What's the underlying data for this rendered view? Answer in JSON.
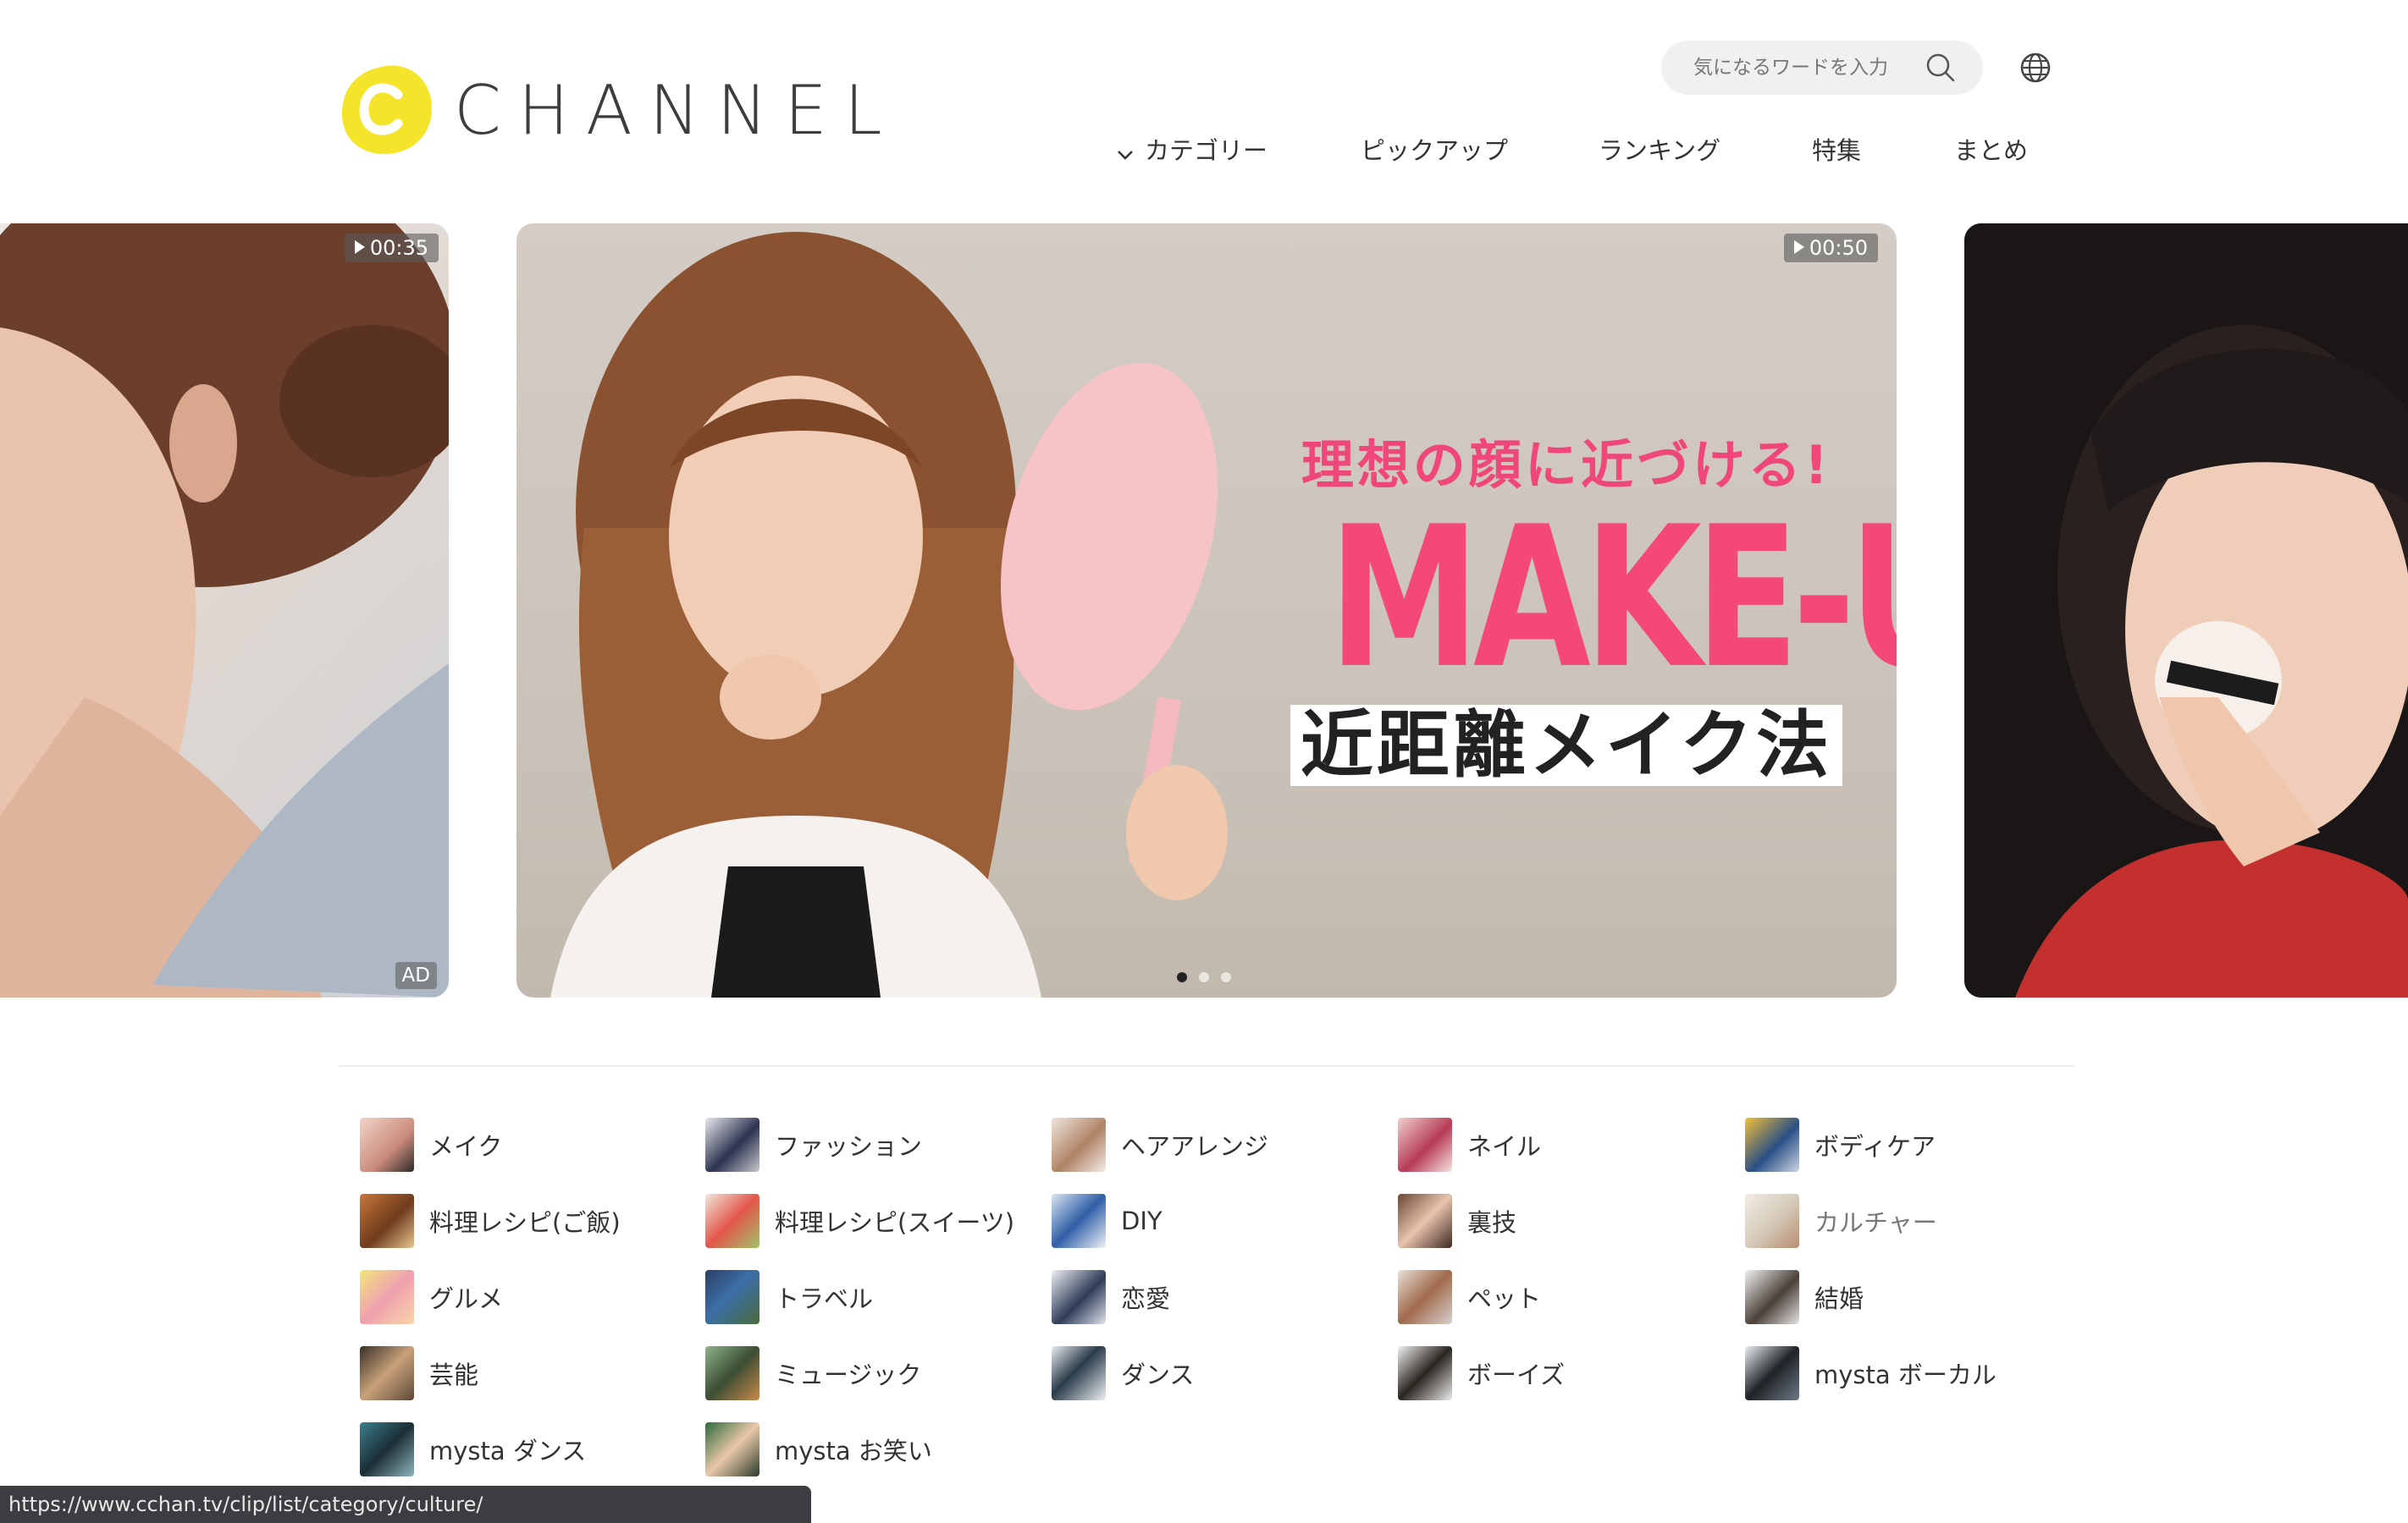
{
  "header": {
    "logo_text": "CHANNEL",
    "search_placeholder": "気になるワードを入力",
    "brand_color": "#f5e52a"
  },
  "nav": [
    {
      "label": "カテゴリー",
      "has_dropdown": true
    },
    {
      "label": "ピックアップ"
    },
    {
      "label": "ランキング"
    },
    {
      "label": "特集"
    },
    {
      "label": "まとめ"
    }
  ],
  "carousel": {
    "left": {
      "duration": "00:35",
      "badge": "AD"
    },
    "main": {
      "duration": "00:50",
      "subtitle": "理想の顔に近づける!",
      "title": "MAKE-UP",
      "caption": "近距離メイク法",
      "accent_color": "#f4487a"
    },
    "active_dot": 0,
    "dot_count": 3
  },
  "categories": [
    {
      "label": "メイク",
      "icon": "makeup-thumb"
    },
    {
      "label": "ファッション",
      "icon": "fashion-thumb"
    },
    {
      "label": "ヘアアレンジ",
      "icon": "hair-thumb"
    },
    {
      "label": "ネイル",
      "icon": "nail-thumb"
    },
    {
      "label": "ボディケア",
      "icon": "bodycare-thumb"
    },
    {
      "label": "料理レシピ(ご飯)",
      "icon": "recipe-meal-thumb"
    },
    {
      "label": "料理レシピ(スイーツ)",
      "icon": "recipe-sweets-thumb"
    },
    {
      "label": "DIY",
      "icon": "diy-thumb"
    },
    {
      "label": "裏技",
      "icon": "tips-thumb"
    },
    {
      "label": "カルチャー",
      "icon": "culture-thumb"
    },
    {
      "label": "グルメ",
      "icon": "gourmet-thumb"
    },
    {
      "label": "トラベル",
      "icon": "travel-thumb"
    },
    {
      "label": "恋愛",
      "icon": "love-thumb"
    },
    {
      "label": "ペット",
      "icon": "pet-thumb"
    },
    {
      "label": "結婚",
      "icon": "wedding-thumb"
    },
    {
      "label": "芸能",
      "icon": "entertainment-thumb"
    },
    {
      "label": "ミュージック",
      "icon": "music-thumb"
    },
    {
      "label": "ダンス",
      "icon": "dance-thumb"
    },
    {
      "label": "ボーイズ",
      "icon": "boys-thumb"
    },
    {
      "label": "mysta ボーカル",
      "icon": "mysta-vocal-thumb"
    },
    {
      "label": "mysta ダンス",
      "icon": "mysta-dance-thumb"
    },
    {
      "label": "mysta お笑い",
      "icon": "mysta-comedy-thumb"
    }
  ],
  "status_bar": {
    "url": "https://www.cchan.tv/clip/list/category/culture/"
  }
}
